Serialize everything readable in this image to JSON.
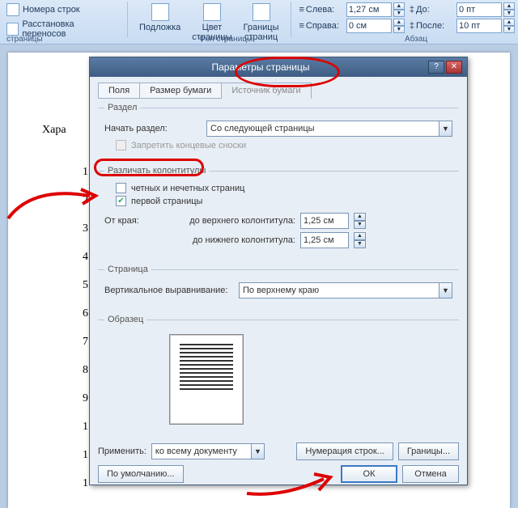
{
  "ribbon": {
    "btn_line_numbers": "Номера строк",
    "btn_hyphenation": "Расстановка переносов",
    "group_page_setup": "страницы",
    "btn_watermark": "Подложка",
    "btn_page_color": "Цвет\nстраницы",
    "btn_page_borders": "Границы\nстраниц",
    "group_page_background": "Фон страницы",
    "indent_left_label": "Слева:",
    "indent_left_value": "1,27 см",
    "indent_right_label": "Справа:",
    "indent_right_value": "0 см",
    "spacing_before_label": "До:",
    "spacing_before_value": "0 пт",
    "spacing_after_label": "После:",
    "spacing_after_value": "10 пт",
    "group_paragraph": "Абзац"
  },
  "doc": {
    "hara": "Хара",
    "nums": [
      "1",
      "2",
      "3",
      "4",
      "5",
      "6",
      "7",
      "8",
      "9",
      "1",
      "1",
      "1"
    ]
  },
  "dialog": {
    "title": "Параметры страницы",
    "tab_margins": "Поля",
    "tab_paper": "Размер бумаги",
    "tab_layout": "Источник бумаги",
    "section_legend": "Раздел",
    "section_start_label": "Начать раздел:",
    "section_start_value": "Со следующей страницы",
    "suppress_endnotes": "Запретить концевые сноски",
    "headers_legend": "Различать колонтитулы",
    "odd_even": "четных и нечетных страниц",
    "first_page": "первой страницы",
    "from_edge_label": "От края:",
    "header_distance_label": "до верхнего колонтитула:",
    "header_distance_value": "1,25 см",
    "footer_distance_label": "до нижнего колонтитула:",
    "footer_distance_value": "1,25 см",
    "page_legend": "Страница",
    "valign_label": "Вертикальное выравнивание:",
    "valign_value": "По верхнему краю",
    "preview_legend": "Образец",
    "apply_to_label": "Применить:",
    "apply_to_value": "ко всему документу",
    "btn_line_numbers": "Нумерация строк...",
    "btn_borders": "Границы...",
    "btn_default": "По умолчанию...",
    "btn_ok": "ОК",
    "btn_cancel": "Отмена"
  }
}
